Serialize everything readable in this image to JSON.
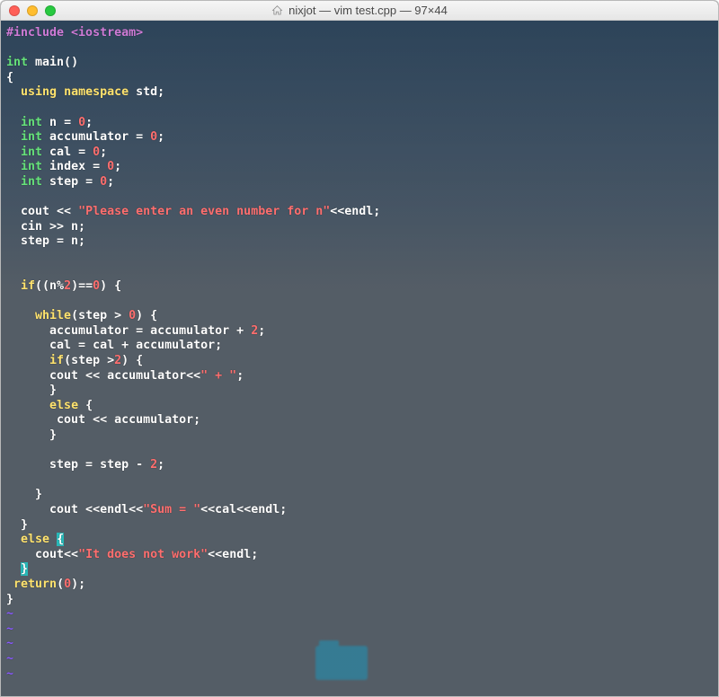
{
  "window": {
    "title": "nixjot — vim test.cpp — 97×44"
  },
  "colors": {
    "preproc": "#cf7bd6",
    "type": "#66e27a",
    "keyword": "#ffe36e",
    "literal": "#ff6f6f",
    "tilde": "#8a5cff",
    "error_bg": "#28b8b8"
  },
  "code_tokens": [
    [
      [
        "preproc",
        "#include <iostream>"
      ]
    ],
    [],
    [
      [
        "type",
        "int"
      ],
      [
        "plain",
        " main()"
      ]
    ],
    [
      [
        "plain",
        "{"
      ]
    ],
    [
      [
        "plain",
        "  "
      ],
      [
        "keyword",
        "using"
      ],
      [
        "plain",
        " "
      ],
      [
        "keyword",
        "namespace"
      ],
      [
        "plain",
        " std;"
      ]
    ],
    [],
    [
      [
        "plain",
        "  "
      ],
      [
        "type",
        "int"
      ],
      [
        "plain",
        " n = "
      ],
      [
        "number",
        "0"
      ],
      [
        "plain",
        ";"
      ]
    ],
    [
      [
        "plain",
        "  "
      ],
      [
        "type",
        "int"
      ],
      [
        "plain",
        " accumulator = "
      ],
      [
        "number",
        "0"
      ],
      [
        "plain",
        ";"
      ]
    ],
    [
      [
        "plain",
        "  "
      ],
      [
        "type",
        "int"
      ],
      [
        "plain",
        " cal = "
      ],
      [
        "number",
        "0"
      ],
      [
        "plain",
        ";"
      ]
    ],
    [
      [
        "plain",
        "  "
      ],
      [
        "type",
        "int"
      ],
      [
        "plain",
        " index = "
      ],
      [
        "number",
        "0"
      ],
      [
        "plain",
        ";"
      ]
    ],
    [
      [
        "plain",
        "  "
      ],
      [
        "type",
        "int"
      ],
      [
        "plain",
        " step = "
      ],
      [
        "number",
        "0"
      ],
      [
        "plain",
        ";"
      ]
    ],
    [],
    [
      [
        "plain",
        "  cout << "
      ],
      [
        "string",
        "\"Please enter an even number for n\""
      ],
      [
        "plain",
        "<<endl;"
      ]
    ],
    [
      [
        "plain",
        "  cin >> n;"
      ]
    ],
    [
      [
        "plain",
        "  step = n;"
      ]
    ],
    [],
    [],
    [
      [
        "plain",
        "  "
      ],
      [
        "keyword",
        "if"
      ],
      [
        "plain",
        "((n%"
      ],
      [
        "number",
        "2"
      ],
      [
        "plain",
        ")=="
      ],
      [
        "number",
        "0"
      ],
      [
        "plain",
        ") {"
      ]
    ],
    [],
    [
      [
        "plain",
        "    "
      ],
      [
        "keyword",
        "while"
      ],
      [
        "plain",
        "(step > "
      ],
      [
        "number",
        "0"
      ],
      [
        "plain",
        ") {"
      ]
    ],
    [
      [
        "plain",
        "      accumulator = accumulator + "
      ],
      [
        "number",
        "2"
      ],
      [
        "plain",
        ";"
      ]
    ],
    [
      [
        "plain",
        "      cal = cal + accumulator;"
      ]
    ],
    [
      [
        "plain",
        "      "
      ],
      [
        "keyword",
        "if"
      ],
      [
        "plain",
        "(step >"
      ],
      [
        "number",
        "2"
      ],
      [
        "plain",
        ") {"
      ]
    ],
    [
      [
        "plain",
        "      cout << accumulator<<"
      ],
      [
        "string",
        "\" + \""
      ],
      [
        "plain",
        ";"
      ]
    ],
    [
      [
        "plain",
        "      }"
      ]
    ],
    [
      [
        "plain",
        "      "
      ],
      [
        "keyword",
        "else"
      ],
      [
        "plain",
        " {"
      ]
    ],
    [
      [
        "plain",
        "       cout << accumulator;"
      ]
    ],
    [
      [
        "plain",
        "      }"
      ]
    ],
    [],
    [
      [
        "plain",
        "      step = step - "
      ],
      [
        "number",
        "2"
      ],
      [
        "plain",
        ";"
      ]
    ],
    [],
    [
      [
        "plain",
        "    }"
      ]
    ],
    [
      [
        "plain",
        "      cout <<endl<<"
      ],
      [
        "string",
        "\"Sum = \""
      ],
      [
        "plain",
        "<<cal<<endl;"
      ]
    ],
    [
      [
        "plain",
        "  }"
      ]
    ],
    [
      [
        "plain",
        "  "
      ],
      [
        "keyword",
        "else"
      ],
      [
        "plain",
        " "
      ],
      [
        "error",
        "{"
      ]
    ],
    [
      [
        "plain",
        "    cout<<"
      ],
      [
        "string",
        "\"It does not work\""
      ],
      [
        "plain",
        "<<endl;"
      ]
    ],
    [
      [
        "plain",
        "  "
      ],
      [
        "error",
        "}"
      ]
    ],
    [
      [
        "plain",
        " "
      ],
      [
        "keyword",
        "return"
      ],
      [
        "plain",
        "("
      ],
      [
        "number",
        "0"
      ],
      [
        "plain",
        ");"
      ]
    ],
    [
      [
        "plain",
        "}"
      ]
    ],
    [
      [
        "tilde",
        "~"
      ]
    ],
    [
      [
        "tilde",
        "~"
      ]
    ],
    [
      [
        "tilde",
        "~"
      ]
    ],
    [
      [
        "tilde",
        "~"
      ]
    ],
    [
      [
        "tilde",
        "~"
      ]
    ]
  ]
}
